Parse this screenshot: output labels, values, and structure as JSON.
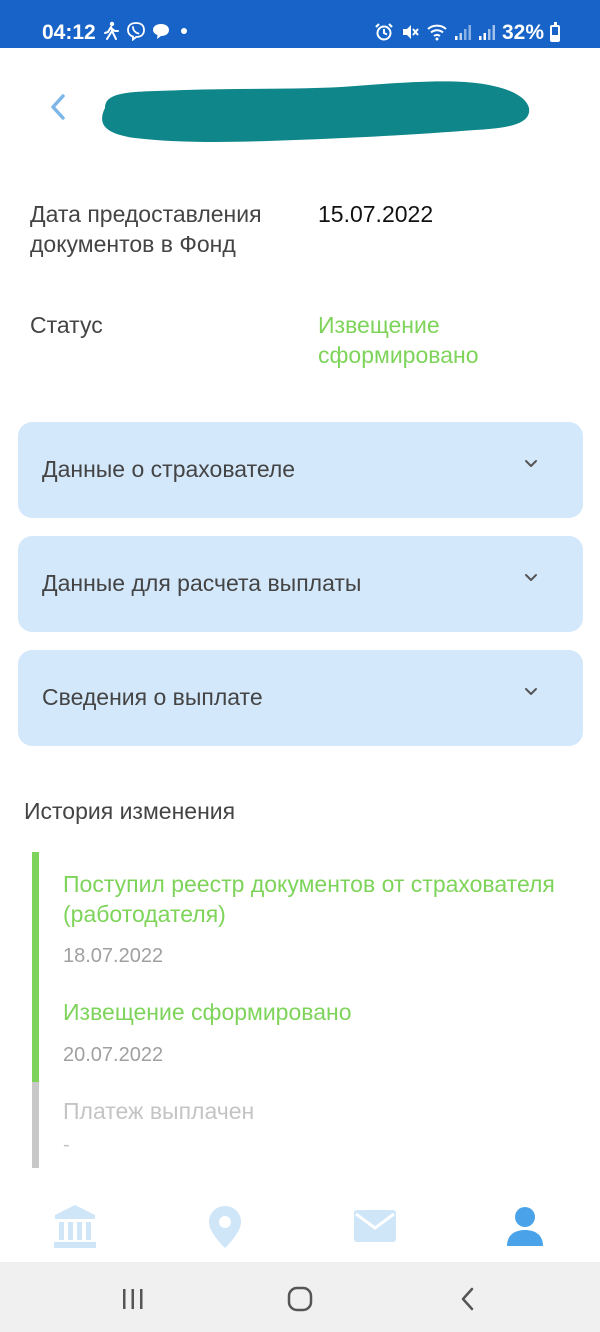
{
  "status_bar": {
    "time": "04:12",
    "battery": "32%",
    "battery_level": 0.32,
    "left_icons": [
      "walk-icon",
      "viber-icon",
      "chat-icon",
      "dot-icon"
    ],
    "right_icons": [
      "alarm-icon",
      "mute-icon",
      "wifi-icon",
      "signal-icon",
      "signal-icon",
      "battery-icon"
    ],
    "color": "#1763c7"
  },
  "header": {
    "back_icon": "chevron-left-icon",
    "title": ""
  },
  "info": {
    "submission_label": "Дата предоставления документов в Фонд",
    "submission_date": "15.07.2022",
    "status_label": "Статус",
    "status_value": "Извещение сформировано"
  },
  "accordions": [
    {
      "label": "Данные о страхователе"
    },
    {
      "label": "Данные для расчета выплаты"
    },
    {
      "label": "Сведения о выплате"
    }
  ],
  "history": {
    "title": "История изменения",
    "items": [
      {
        "title": "Поступил реестр документов от страхователя (работодателя)",
        "date": "18.07.2022",
        "state": "done"
      },
      {
        "title": "Извещение сформировано",
        "date": "20.07.2022",
        "state": "done"
      },
      {
        "title": "Платеж выплачен",
        "date": "-",
        "state": "pending"
      }
    ]
  },
  "bottom_nav": {
    "items": [
      "bank-icon",
      "location-pin-icon",
      "mail-icon",
      "profile-icon"
    ],
    "active": "profile-icon"
  },
  "colors": {
    "accent": "#7ed45a",
    "card": "#d4e8fb",
    "nav_inactive": "#cfe5f8",
    "nav_active": "#4aa3e8"
  }
}
